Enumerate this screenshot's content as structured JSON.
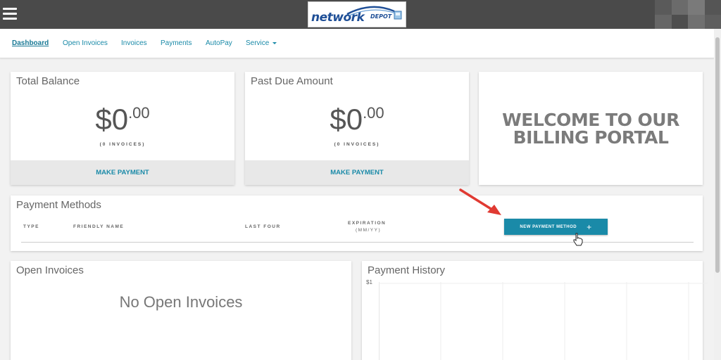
{
  "nav": {
    "items": [
      {
        "label": "Dashboard",
        "active": true
      },
      {
        "label": "Open Invoices"
      },
      {
        "label": "Invoices"
      },
      {
        "label": "Payments"
      },
      {
        "label": "AutoPay"
      },
      {
        "label": "Service"
      }
    ]
  },
  "logo": {
    "main": "network",
    "sub": "DEPOT"
  },
  "cards": {
    "total_balance": {
      "title": "Total Balance",
      "dollar": "$0",
      "cents": ".00",
      "count": "(0 INVOICES)",
      "action": "MAKE PAYMENT"
    },
    "past_due": {
      "title": "Past Due Amount",
      "dollar": "$0",
      "cents": ".00",
      "count": "(0 INVOICES)",
      "action": "MAKE PAYMENT"
    },
    "welcome": {
      "line1": "WELCOME TO OUR",
      "line2": "BILLING PORTAL"
    }
  },
  "payment_methods": {
    "title": "Payment Methods",
    "columns": {
      "type": "TYPE",
      "friendly_name": "FRIENDLY NAME",
      "last_four": "LAST FOUR",
      "expiration": "EXPIRATION",
      "expiration_sub": "(MM/YY)"
    },
    "button": "NEW PAYMENT METHOD",
    "button_icon": "+"
  },
  "open_invoices": {
    "title": "Open Invoices",
    "empty": "No Open Invoices"
  },
  "payment_history": {
    "title": "Payment History",
    "y_label": "$1"
  },
  "colors": {
    "accent": "#1a8aa8",
    "topbar": "#4a4a4a",
    "arrow": "#e03a32"
  }
}
